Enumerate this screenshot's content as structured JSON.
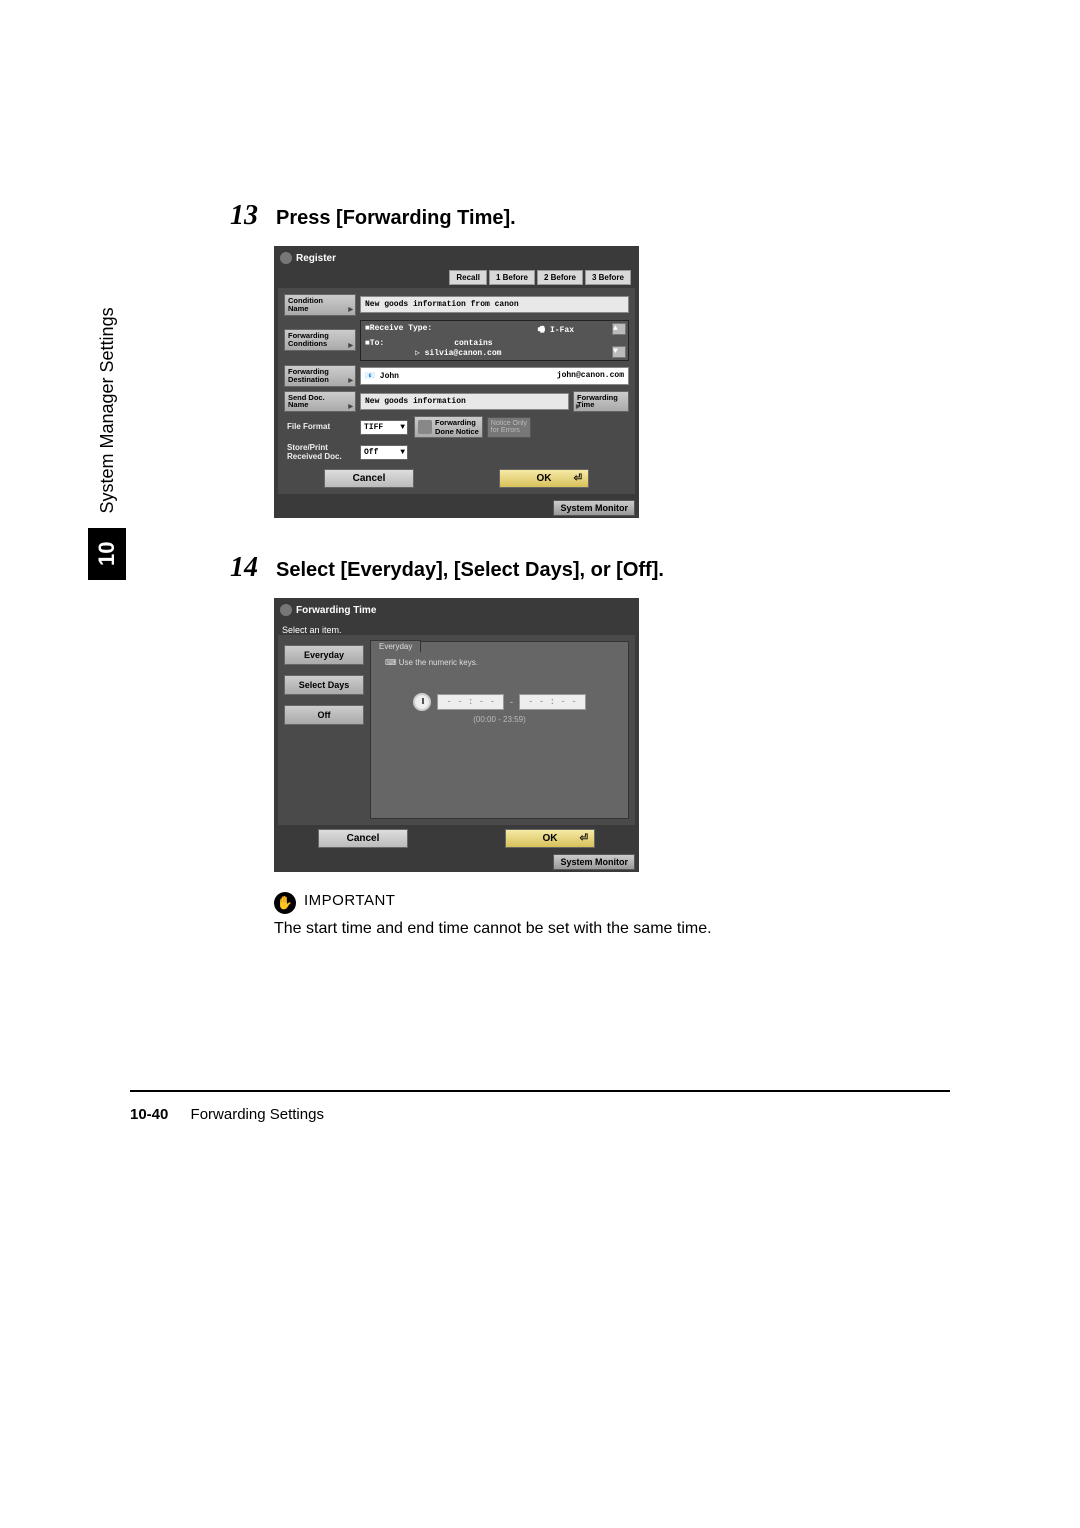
{
  "steps": {
    "s13": {
      "num": "13",
      "text": "Press [Forwarding Time]."
    },
    "s14": {
      "num": "14",
      "text": "Select [Everyday], [Select Days], or [Off]."
    }
  },
  "shot1": {
    "title": "Register",
    "history": [
      "Recall",
      "1 Before",
      "2 Before",
      "3 Before"
    ],
    "condition_name_label": "Condition\nName",
    "condition_name_value": "New goods information from canon",
    "fwd_cond_label": "Forwarding\nConditions",
    "recv_type_label": "■Receive Type:",
    "recv_type_value": "I-Fax",
    "to_label": "■To:",
    "to_op": "contains",
    "to_value": "▷ silvia@canon.com",
    "fwd_dest_label": "Forwarding\nDestination",
    "dest_name": "John",
    "dest_addr": "john@canon.com",
    "send_doc_label": "Send Doc.\nName",
    "send_doc_value": "New goods information",
    "fwd_time_label": "Forwarding\nTime",
    "file_format_label": "File Format",
    "file_format_value": "TIFF",
    "store_print_label": "Store/Print\nReceived Doc.",
    "store_print_value": "Off",
    "done_notice_label": "Forwarding\nDone Notice",
    "err_only_label": "Notice Only\nfor Errors",
    "cancel": "Cancel",
    "ok": "OK",
    "sysmon": "System Monitor"
  },
  "shot2": {
    "title": "Forwarding Time",
    "subtitle": "Select an item.",
    "options": [
      "Everyday",
      "Select Days",
      "Off"
    ],
    "tab": "Everyday",
    "hint": "Use the numeric keys.",
    "time1": "- - : - -",
    "time2": "- - : - -",
    "range": "(00:00 - 23:59)",
    "cancel": "Cancel",
    "ok": "OK",
    "sysmon": "System Monitor"
  },
  "important": {
    "label": "IMPORTANT",
    "text": "The start time and end time cannot be set with the same time."
  },
  "sidebar": {
    "chapter": "10",
    "title": "System Manager Settings"
  },
  "footer": {
    "page": "10-40",
    "section": "Forwarding Settings"
  }
}
